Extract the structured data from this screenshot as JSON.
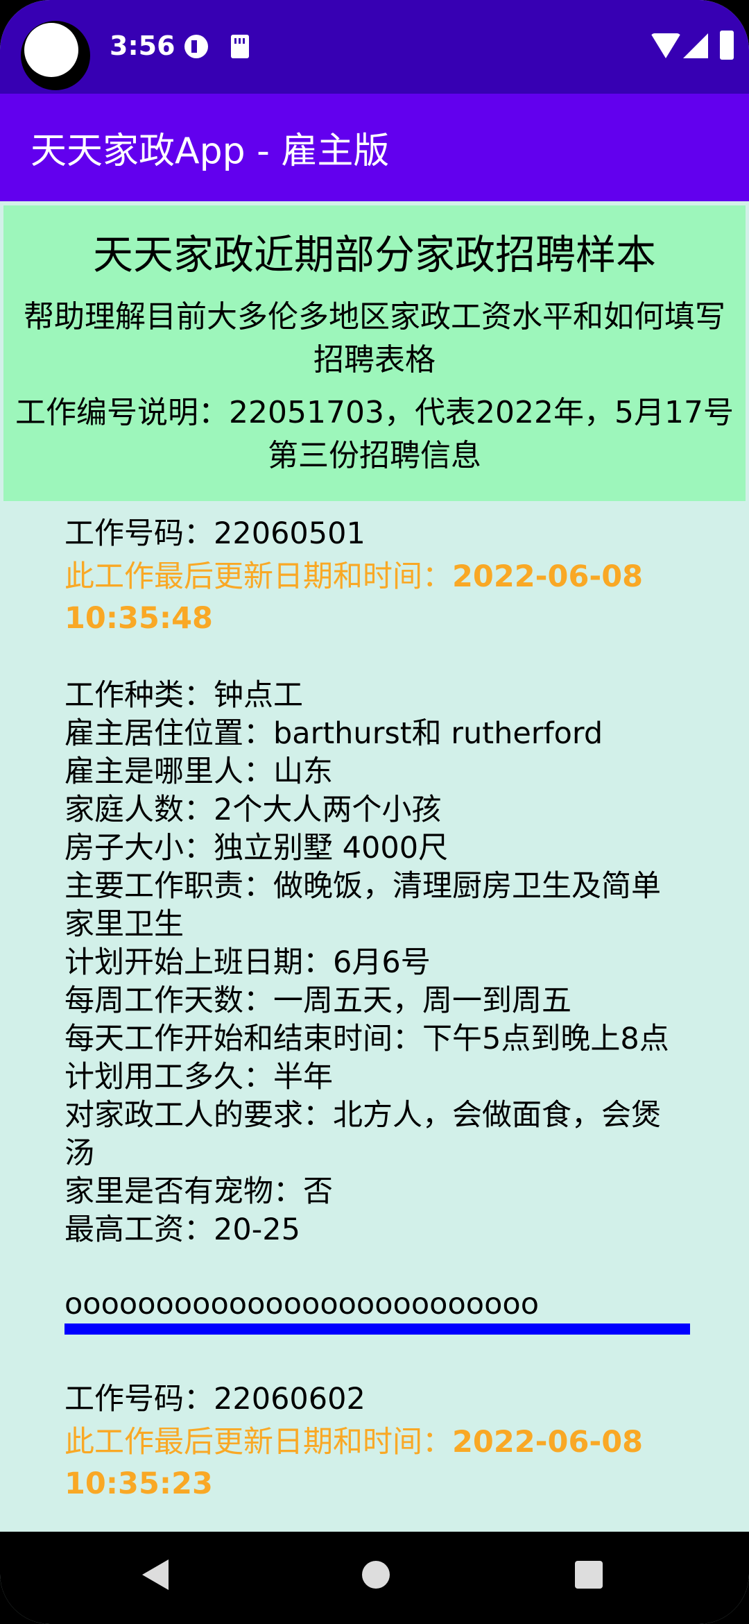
{
  "status_bar": {
    "time": "3:56",
    "icons": [
      "camera-cutout",
      "app-notification-icon",
      "sd-card-icon",
      "wifi-icon",
      "signal-icon",
      "battery-icon"
    ]
  },
  "app_bar": {
    "title": "天天家政App - 雇主版"
  },
  "header": {
    "title": "天天家政近期部分家政招聘样本",
    "subtitle": "帮助理解目前大多伦多地区家政工资水平和如何填写招聘表格",
    "note": "工作编号说明：22051703，代表2022年，5月17号第三份招聘信息"
  },
  "jobs": [
    {
      "number": "工作号码：22060501",
      "updated_label": "此工作最后更新日期和时间：",
      "updated_value": "2022-06-08 10:35:48",
      "details": [
        "工作种类：钟点工",
        "雇主居住位置：barthurst和 rutherford",
        "雇主是哪里人：山东",
        "家庭人数：2个大人两个小孩",
        "房子大小：独立别墅 4000尺",
        "主要工作职责：做晚饭，清理厨房卫生及简单家里卫生",
        "计划开始上班日期：6月6号",
        "每周工作天数：一周五天，周一到周五",
        "每天工作开始和结束时间：下午5点到晚上8点",
        "计划用工多久：半年",
        "对家政工人的要求：北方人，会做面食，会煲汤",
        "家里是否有宠物：否",
        "最高工资：20-25"
      ],
      "separator": "oooooooooooooooooooooooooo"
    },
    {
      "number": "工作号码：22060602",
      "updated_label": "此工作最后更新日期和时间：",
      "updated_value": "2022-06-08 10:35:23"
    }
  ],
  "colors": {
    "status_bar": "#3700b3",
    "app_bar": "#6200ee",
    "header_bg": "#9df6bb",
    "content_bg": "#d2f0e9",
    "updated_text": "#f9a825",
    "divider": "#0000ff"
  },
  "nav_bar": {
    "icons": [
      "back-icon",
      "home-icon",
      "recents-icon"
    ]
  }
}
